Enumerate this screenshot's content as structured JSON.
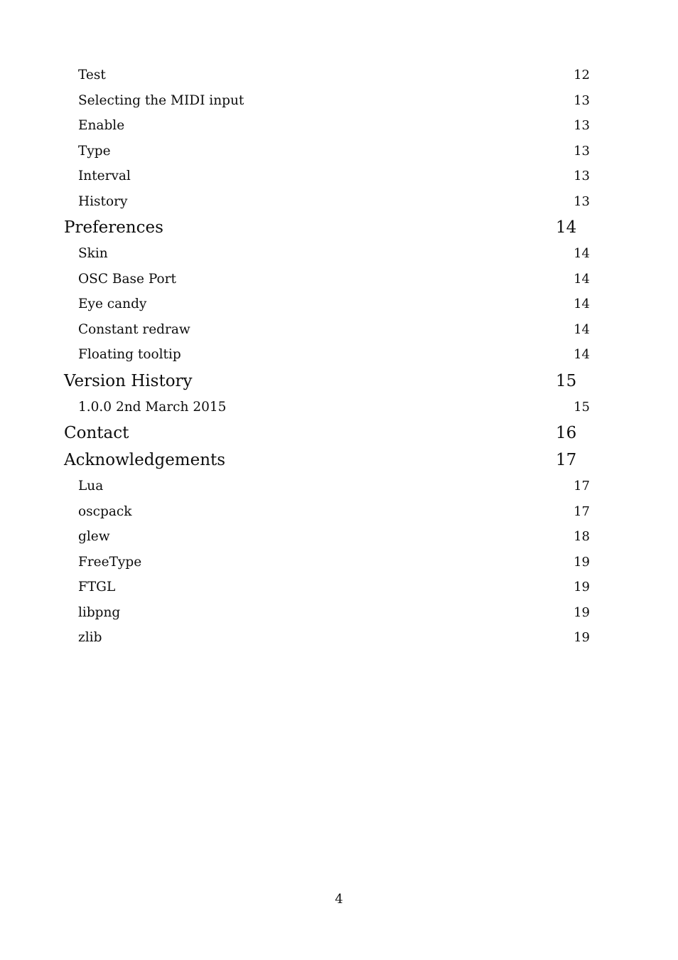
{
  "document": {
    "type": "table-of-contents",
    "footer_page_number": "4",
    "text_color": "#0d0d0d",
    "background_color": "#ffffff"
  },
  "toc": {
    "entries": [
      {
        "level": 2,
        "label": "Test",
        "page": "12"
      },
      {
        "level": 2,
        "label": "Selecting the MIDI input",
        "page": "13"
      },
      {
        "level": 2,
        "label": "Enable",
        "page": "13"
      },
      {
        "level": 2,
        "label": "Type",
        "page": "13"
      },
      {
        "level": 2,
        "label": "Interval",
        "page": "13"
      },
      {
        "level": 2,
        "label": "History",
        "page": "13"
      },
      {
        "level": 1,
        "label": "Preferences",
        "page": "14"
      },
      {
        "level": 2,
        "label": "Skin",
        "page": "14"
      },
      {
        "level": 2,
        "label": "OSC Base Port",
        "page": "14"
      },
      {
        "level": 2,
        "label": "Eye candy",
        "page": "14"
      },
      {
        "level": 2,
        "label": "Constant redraw",
        "page": "14"
      },
      {
        "level": 2,
        "label": "Floating tooltip",
        "page": "14"
      },
      {
        "level": 1,
        "label": "Version History",
        "page": "15"
      },
      {
        "level": 2,
        "label": "1.0.0 2nd March 2015",
        "page": "15"
      },
      {
        "level": 1,
        "label": "Contact",
        "page": "16"
      },
      {
        "level": 1,
        "label": "Acknowledgements",
        "page": "17"
      },
      {
        "level": 2,
        "label": "Lua",
        "page": "17"
      },
      {
        "level": 2,
        "label": "oscpack",
        "page": "17"
      },
      {
        "level": 2,
        "label": "glew",
        "page": "18"
      },
      {
        "level": 2,
        "label": "FreeType",
        "page": "19"
      },
      {
        "level": 2,
        "label": "FTGL",
        "page": "19"
      },
      {
        "level": 2,
        "label": "libpng",
        "page": "19"
      },
      {
        "level": 2,
        "label": "zlib",
        "page": "19"
      }
    ]
  }
}
